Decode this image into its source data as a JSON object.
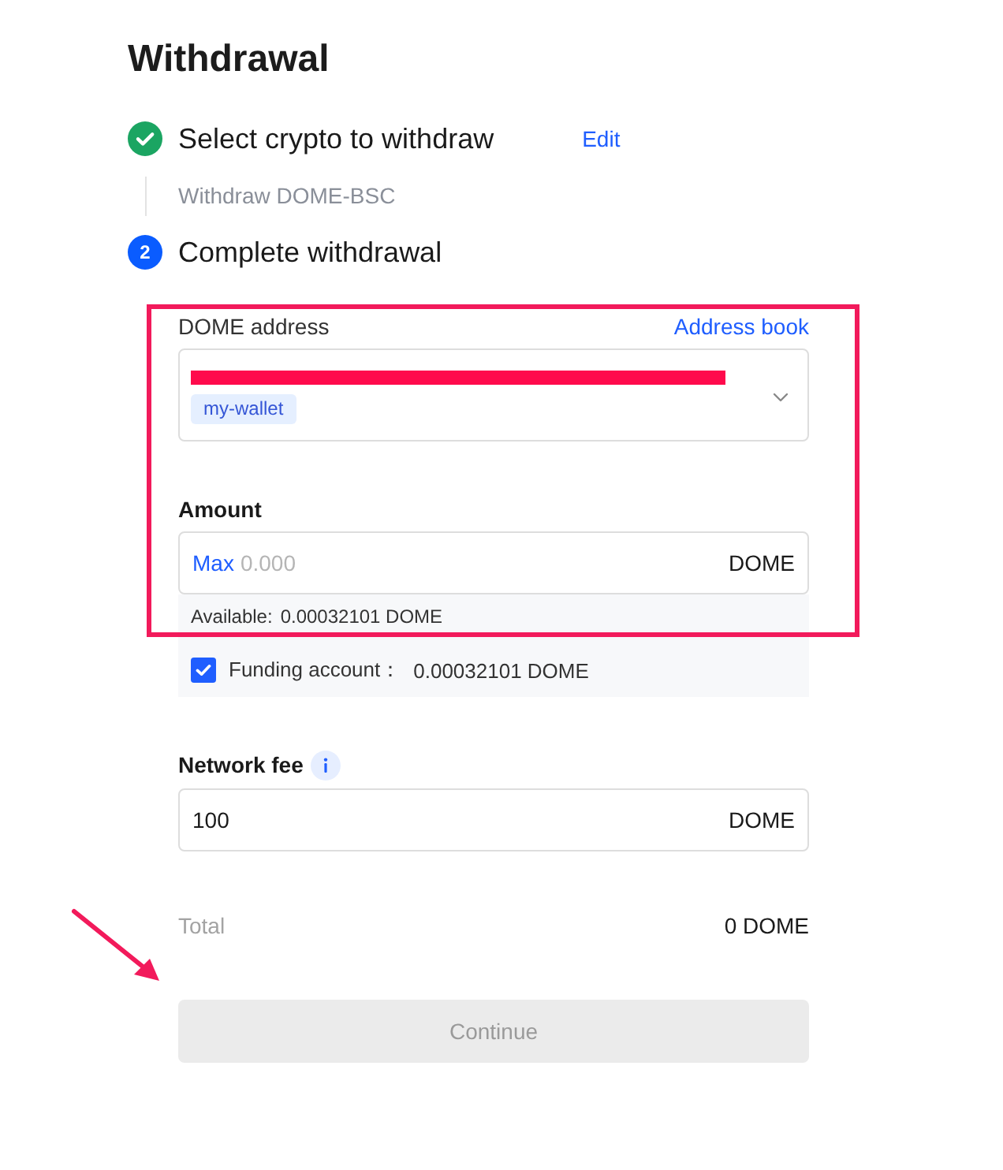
{
  "title": "Withdrawal",
  "steps": [
    {
      "completed": true,
      "title": "Select crypto to withdraw",
      "action": "Edit",
      "summary": "Withdraw DOME-BSC"
    },
    {
      "completed": false,
      "number": "2",
      "title": "Complete withdrawal"
    }
  ],
  "address": {
    "label": "DOME address",
    "link": "Address book",
    "redacted": true,
    "tag": "my-wallet"
  },
  "amount": {
    "label": "Amount",
    "max": "Max",
    "placeholder": "0.000",
    "unit": "DOME",
    "available_label": "Available:",
    "available_value": "0.00032101 DOME",
    "funding": {
      "checked": true,
      "label": "Funding account：",
      "value": "0.00032101 DOME"
    }
  },
  "network_fee": {
    "label": "Network fee",
    "info": true,
    "value": "100",
    "unit": "DOME"
  },
  "total": {
    "label": "Total",
    "value": "0 DOME"
  },
  "continue_button": {
    "label": "Continue",
    "disabled": true
  },
  "annotations": {
    "highlight": true,
    "arrow": true
  }
}
